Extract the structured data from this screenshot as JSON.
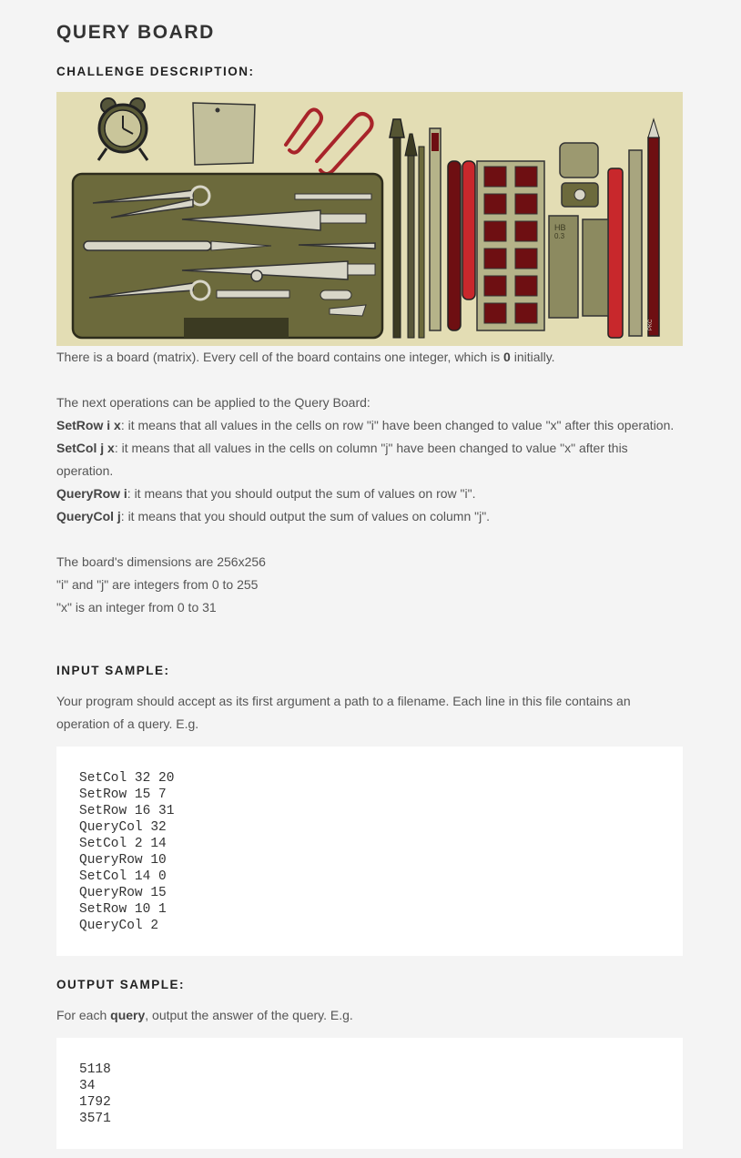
{
  "page_title": "QUERY BOARD",
  "sections": {
    "challenge": "CHALLENGE DESCRIPTION:",
    "input": "INPUT SAMPLE:",
    "output": "OUTPUT SAMPLE:"
  },
  "description": {
    "intro_before": "There is a board (matrix). Every cell of the board contains one integer, which is ",
    "intro_bold": "0",
    "intro_after": " initially.",
    "ops_intro": "The next operations can be applied to the Query Board:",
    "ops": [
      {
        "cmd": "SetRow",
        "arg": " i x",
        "text": ": it means that all values in the cells on row \"i\" have been changed to value \"x\" after this operation."
      },
      {
        "cmd": "SetCol",
        "arg": " j x",
        "text": ": it means that all values in the cells on column \"j\" have been changed to value \"x\" after this operation."
      },
      {
        "cmd": "QueryRow",
        "arg": " i",
        "text": ": it means that you should output the sum of values on row \"i\"."
      },
      {
        "cmd": "QueryCol",
        "arg": " j",
        "text": ": it means that you should output the sum of values on column \"j\"."
      }
    ],
    "dims": [
      "The board's dimensions are 256x256",
      "\"i\" and \"j\" are integers from 0 to 255",
      "\"x\" is an integer from 0 to 31"
    ]
  },
  "input_text": "Your program should accept as its first argument a path to a filename. Each line in this file contains an operation of a query. E.g.",
  "input_code": "SetCol 32 20\nSetRow 15 7\nSetRow 16 31\nQueryCol 32\nSetCol 2 14\nQueryRow 10\nSetCol 14 0\nQueryRow 15\nSetRow 10 1\nQueryCol 2",
  "output_text": {
    "before": "For each ",
    "bold": "query",
    "after": ", output the answer of the query. E.g."
  },
  "output_code": "5118\n34\n1792\n3571",
  "illustration": {
    "icons": [
      "alarm-clock-icon",
      "sticky-note-icon",
      "paper-clip-icon",
      "drafting-set-icon",
      "brushes-icon",
      "pencils-icon",
      "paint-palette-icon",
      "sharpener-icon",
      "eraser-icon",
      "lead-box-icon"
    ],
    "label_hb": "HB",
    "label_03": "0.3",
    "label_pkc": "PKC",
    "colors": {
      "background": "#e3ddb4",
      "case": "#6c6a3c",
      "tools": "#d8d6c8",
      "red": "#c8282c",
      "dark_red": "#6e0f12"
    }
  }
}
